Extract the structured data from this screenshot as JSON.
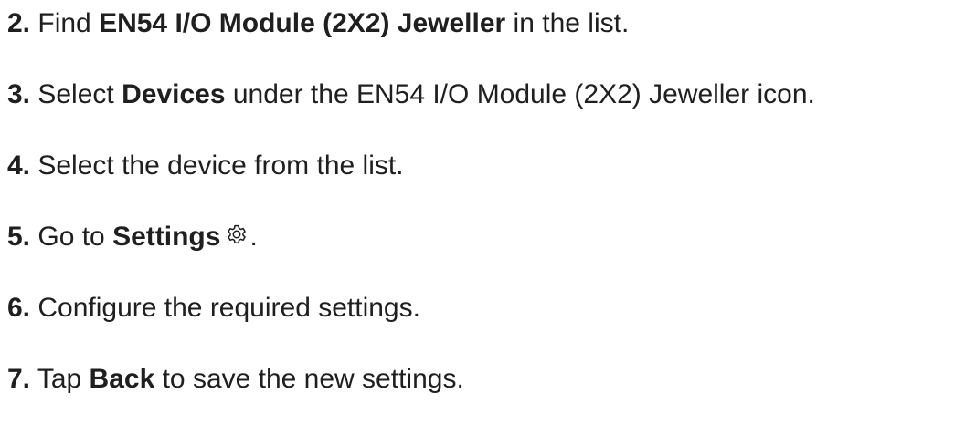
{
  "steps": [
    {
      "num": "2.",
      "before": " Find ",
      "bold": "EN54 I/O Module (2X2) Jeweller",
      "after": " in the list."
    },
    {
      "num": "3.",
      "before": " Select ",
      "bold": "Devices",
      "after": " under the EN54 I/O Module (2X2) Jeweller icon."
    },
    {
      "num": "4.",
      "text": " Select the device from the list."
    },
    {
      "num": "5.",
      "before": " Go to ",
      "bold": "Settings",
      "icon": "gear-icon",
      "after": "."
    },
    {
      "num": "6.",
      "text": " Configure the required settings."
    },
    {
      "num": "7.",
      "before": " Tap ",
      "bold": "Back",
      "after": " to save the new settings."
    }
  ]
}
